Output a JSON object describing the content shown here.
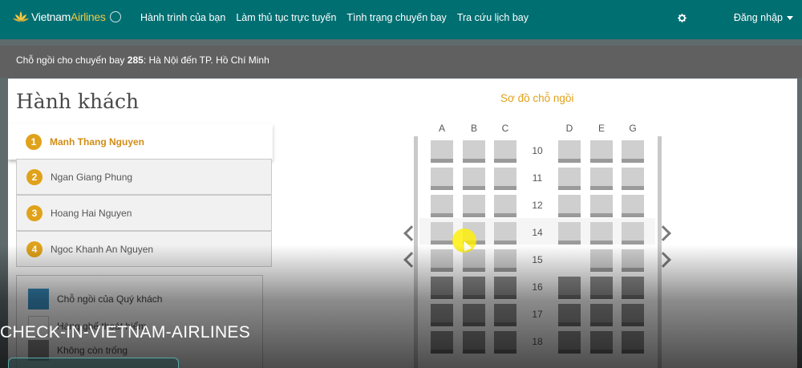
{
  "header": {
    "brand": "Vietnam",
    "brand_suffix": "Airlines",
    "nav": [
      "Hành trình của bạn",
      "Làm thủ tục trực tuyến",
      "Tình trạng chuyến bay",
      "Tra cứu lịch bay"
    ],
    "settings_icon": "gear-icon",
    "login_label": "Đăng nhập"
  },
  "flight_bar": {
    "prefix": "Chỗ ngồi cho chuyến bay",
    "flight_number": "285",
    "route": ": Hà Nội đến TP. Hồ Chí Minh"
  },
  "passengers_panel": {
    "title": "Hành khách",
    "passengers": [
      {
        "num": "1",
        "name": "Manh Thang Nguyen",
        "active": true
      },
      {
        "num": "2",
        "name": "Ngan Giang Phung",
        "active": false
      },
      {
        "num": "3",
        "name": "Hoang Hai Nguyen",
        "active": false
      },
      {
        "num": "4",
        "name": "Ngoc Khanh An Nguyen",
        "active": false
      }
    ],
    "legend": [
      {
        "label": "Chỗ ngồi của Quý khách",
        "color": "#3a8fc2"
      },
      {
        "label": "Hàng ghế thoát hiểm",
        "color": "#ffffff"
      },
      {
        "label": "Không còn trống",
        "color": "#8e8e8e"
      }
    ]
  },
  "seat_map": {
    "title": "Sơ đồ chỗ ngồi",
    "columns": [
      "A",
      "B",
      "C",
      "D",
      "E",
      "G"
    ],
    "rows": [
      {
        "num": "10",
        "seats": [
          "available",
          "available",
          "available",
          "available",
          "available",
          "available"
        ]
      },
      {
        "num": "11",
        "seats": [
          "available",
          "available",
          "available",
          "available",
          "available",
          "available"
        ]
      },
      {
        "num": "12",
        "seats": [
          "available",
          "available",
          "available",
          "available",
          "available",
          "available"
        ]
      },
      {
        "num": "14",
        "seats": [
          "available",
          "available",
          "available",
          "available",
          "available",
          "available"
        ]
      },
      {
        "num": "15",
        "seats": [
          "available",
          "available",
          "available",
          "none",
          "available",
          "available"
        ]
      },
      {
        "num": "16",
        "seats": [
          "taken",
          "taken",
          "taken",
          "taken",
          "taken",
          "taken"
        ]
      },
      {
        "num": "17",
        "seats": [
          "taken",
          "taken",
          "taken",
          "taken",
          "taken",
          "taken"
        ]
      },
      {
        "num": "18",
        "seats": [
          "taken",
          "taken",
          "taken",
          "taken",
          "taken",
          "taken"
        ]
      }
    ]
  },
  "watermark": "CHECK-IN-VIETNAM-AIRLINES"
}
